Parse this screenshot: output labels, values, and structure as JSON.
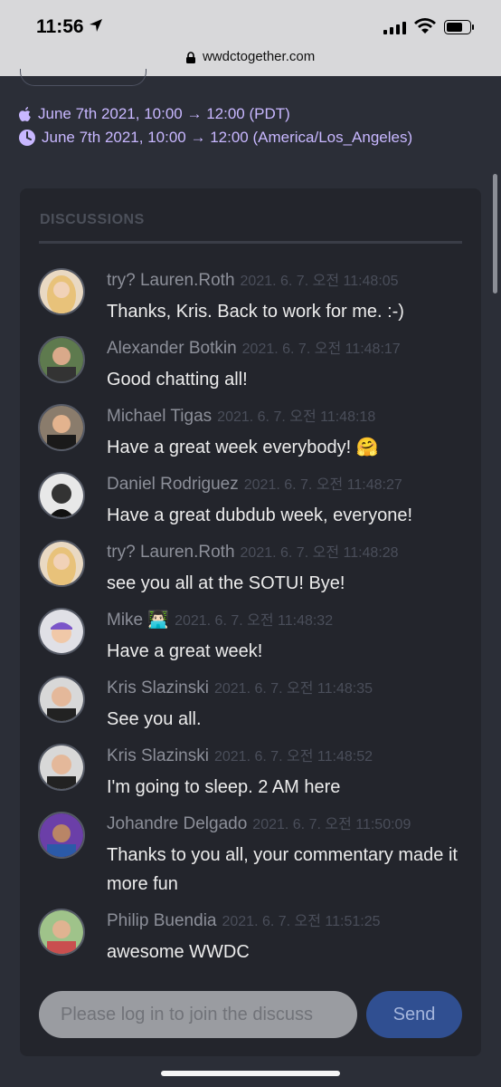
{
  "status_bar": {
    "time": "11:56"
  },
  "browser": {
    "url": "wwdctogether.com"
  },
  "event": {
    "date_pdt": "June 7th 2021, 10:00 → 12:00 (PDT)",
    "date_local": "June 7th 2021, 10:00 → 12:00 (America/Los_Angeles)"
  },
  "discussions": {
    "title": "DISCUSSIONS",
    "messages": [
      {
        "author": "try? Lauren.Roth",
        "time": "2021. 6. 7. 오전 11:48:05",
        "text": "Thanks, Kris. Back to work for me. :-)"
      },
      {
        "author": "Alexander Botkin",
        "time": "2021. 6. 7. 오전 11:48:17",
        "text": "Good chatting all!"
      },
      {
        "author": "Michael Tigas",
        "time": "2021. 6. 7. 오전 11:48:18",
        "text": "Have a great week everybody! 🤗"
      },
      {
        "author": "Daniel Rodriguez",
        "time": "2021. 6. 7. 오전 11:48:27",
        "text": "Have a great dubdub week, everyone!"
      },
      {
        "author": "try? Lauren.Roth",
        "time": "2021. 6. 7. 오전 11:48:28",
        "text": "see you all at the SOTU! Bye!"
      },
      {
        "author": "Mike 👨🏻‍💻",
        "time": "2021. 6. 7. 오전 11:48:32",
        "text": "Have a great week!"
      },
      {
        "author": "Kris Slazinski",
        "time": "2021. 6. 7. 오전 11:48:35",
        "text": "See you all."
      },
      {
        "author": "Kris Slazinski",
        "time": "2021. 6. 7. 오전 11:48:52",
        "text": "I'm going to sleep. 2 AM here"
      },
      {
        "author": "Johandre Delgado",
        "time": "2021. 6. 7. 오전 11:50:09",
        "text": "Thanks to you all, your commentary made it more fun"
      },
      {
        "author": "Philip Buendia",
        "time": "2021. 6. 7. 오전 11:51:25",
        "text": "awesome WWDC"
      }
    ],
    "input_placeholder": "Please log in to join the discuss",
    "send_label": "Send"
  },
  "colors": {
    "background": "#2b2e37",
    "panel": "#23252c",
    "accent_purple": "#c8b7ff",
    "send_button": "#304f91"
  }
}
